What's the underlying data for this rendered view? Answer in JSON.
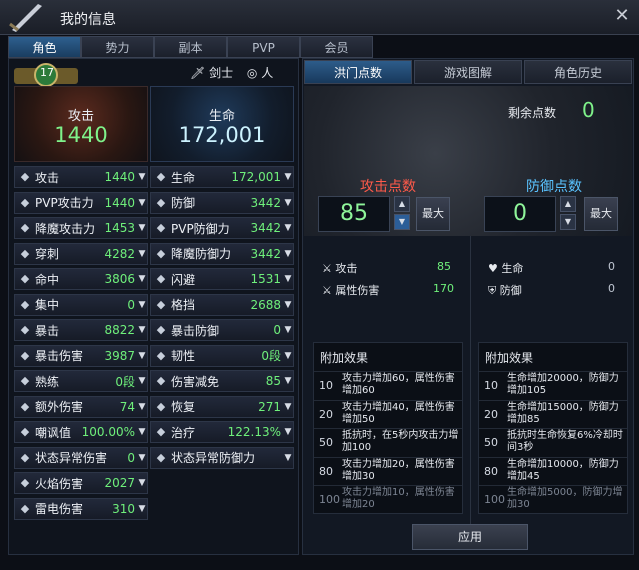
{
  "window": {
    "title": "我的信息",
    "close_glyph": "✕"
  },
  "tabs": [
    "角色",
    "势力",
    "副本",
    "PVP",
    "会员"
  ],
  "level": "17",
  "job": {
    "class": "剑士",
    "race": "人"
  },
  "hero": {
    "atk_label": "攻击",
    "atk_value": "1440",
    "hp_label": "生命",
    "hp_value": "172,001"
  },
  "left_stats": [
    {
      "name": "攻击",
      "value": "1440",
      "icon": "swords-icon"
    },
    {
      "name": "PVP攻击力",
      "value": "1440",
      "icon": "pvp-attack-icon"
    },
    {
      "name": "降魔攻击力",
      "value": "1453",
      "icon": "demon-attack-icon"
    },
    {
      "name": "穿刺",
      "value": "4282",
      "icon": "pierce-icon"
    },
    {
      "name": "命中",
      "value": "3806",
      "icon": "accuracy-icon"
    },
    {
      "name": "集中",
      "value": "0",
      "icon": "focus-icon"
    },
    {
      "name": "暴击",
      "value": "8822",
      "icon": "critical-icon"
    },
    {
      "name": "暴击伤害",
      "value": "3987",
      "icon": "critical-damage-icon"
    },
    {
      "name": "熟练",
      "value": "0段",
      "icon": "mastery-icon"
    },
    {
      "name": "额外伤害",
      "value": "74",
      "icon": "extra-damage-icon"
    },
    {
      "name": "嘲讽值",
      "value": "100.00%",
      "icon": "taunt-icon"
    },
    {
      "name": "状态异常伤害",
      "value": "0",
      "icon": "status-damage-icon"
    },
    {
      "name": "火焰伤害",
      "value": "2027",
      "icon": "fire-icon"
    },
    {
      "name": "雷电伤害",
      "value": "310",
      "icon": "lightning-icon"
    }
  ],
  "right_stats": [
    {
      "name": "生命",
      "value": "172,001",
      "icon": "heart-icon"
    },
    {
      "name": "防御",
      "value": "3442",
      "icon": "shield-icon"
    },
    {
      "name": "PVP防御力",
      "value": "3442",
      "icon": "pvp-shield-icon"
    },
    {
      "name": "降魔防御力",
      "value": "3442",
      "icon": "demon-shield-icon"
    },
    {
      "name": "闪避",
      "value": "1531",
      "icon": "evade-icon"
    },
    {
      "name": "格挡",
      "value": "2688",
      "icon": "block-icon"
    },
    {
      "name": "暴击防御",
      "value": "0",
      "icon": "crit-defense-icon"
    },
    {
      "name": "韧性",
      "value": "0段",
      "icon": "toughness-icon"
    },
    {
      "name": "伤害减免",
      "value": "85",
      "icon": "damage-reduce-icon"
    },
    {
      "name": "恢复",
      "value": "271",
      "icon": "recovery-icon"
    },
    {
      "name": "治疗",
      "value": "122.13%",
      "icon": "heal-icon"
    },
    {
      "name": "状态异常防御力",
      "value": "",
      "icon": "status-defense-icon"
    }
  ],
  "right_tabs": [
    "洪门点数",
    "游戏图解",
    "角色历史"
  ],
  "points": {
    "remain_label": "剩余点数",
    "remain_value": "0",
    "atk_label": "攻击点数",
    "atk_value": "85",
    "def_label": "防御点数",
    "def_value": "0",
    "max_label": "最大"
  },
  "atk_sub": [
    {
      "name": "攻击",
      "value": "85"
    },
    {
      "name": "属性伤害",
      "value": "170"
    }
  ],
  "def_sub": [
    {
      "name": "生命",
      "value": "0"
    },
    {
      "name": "防御",
      "value": "0"
    }
  ],
  "effects_title": "附加效果",
  "atk_effects": [
    {
      "lv": "10",
      "text": "攻击力增加60，属性伤害增加60"
    },
    {
      "lv": "20",
      "text": "攻击力增加40，属性伤害增加50"
    },
    {
      "lv": "50",
      "text": "抵抗时，在5秒内攻击力增加100"
    },
    {
      "lv": "80",
      "text": "攻击力增加20，属性伤害增加30"
    },
    {
      "lv": "100",
      "text": "攻击力增加10，属性伤害增加20"
    }
  ],
  "def_effects": [
    {
      "lv": "10",
      "text": "生命增加20000，防御力增加105"
    },
    {
      "lv": "20",
      "text": "生命增加15000，防御力增加85"
    },
    {
      "lv": "50",
      "text": "抵抗时生命恢复6%冷却时间3秒"
    },
    {
      "lv": "80",
      "text": "生命增加10000，防御力增加45"
    },
    {
      "lv": "100",
      "text": "生命增加5000，防御力增加30"
    }
  ],
  "apply_label": "应用"
}
